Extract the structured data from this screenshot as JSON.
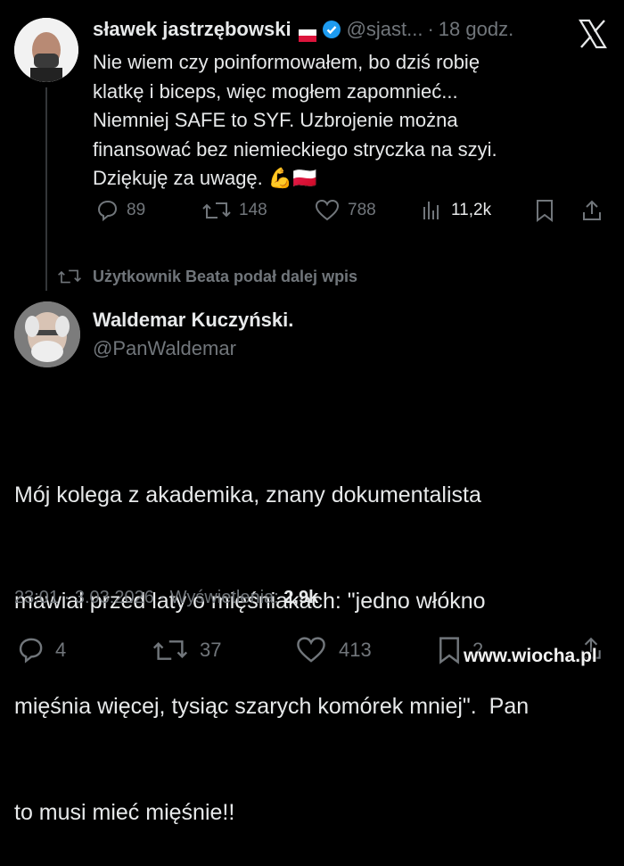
{
  "quoted_tweet": {
    "author_name": "sławek jastrzębowski",
    "flag": "🇵🇱",
    "handle": "@sjast...",
    "separator": "·",
    "time": "18 godz.",
    "text_lines": [
      "Nie wiem czy poinformowałem, bo dziś robię",
      "klatkę i biceps, więc mogłem zapomnieć...",
      "Niemniej SAFE to SYF. Uzbrojenie można",
      "finansować bez niemieckiego stryczka na szyi.",
      "Dziękuję za uwagę. 💪🇵🇱"
    ],
    "stats": {
      "replies": "89",
      "reposts": "148",
      "likes": "788",
      "views": "11,2k"
    }
  },
  "repost_banner": {
    "text": "Użytkownik Beata podał dalej wpis"
  },
  "main_tweet": {
    "author_name": "Waldemar Kuczyński.",
    "handle": "@PanWaldemar",
    "text_lines": [
      "Mój kolega z akademika, znany dokumentalista",
      "mawiał przed laty o mięśniakach: \"jedno włókno",
      "mięśnia więcej, tysiąc szarych komórek mniej\".  Pan",
      "to musi mieć mięśnie!!"
    ],
    "time": "23:01",
    "sep1": "·",
    "date": "3.03.2026",
    "sep2": "·",
    "views_label": "Wyświetlenia:",
    "views_value": "2,9k",
    "stats": {
      "replies": "4",
      "reposts": "37",
      "likes": "413",
      "bookmarks": "2"
    }
  },
  "watermark": "www.wiocha.pl",
  "colors": {
    "background": "#000000",
    "text": "#e7e9ea",
    "muted": "#71767b",
    "verified": "#1d9bf0",
    "flag_red": "#dc143c"
  }
}
